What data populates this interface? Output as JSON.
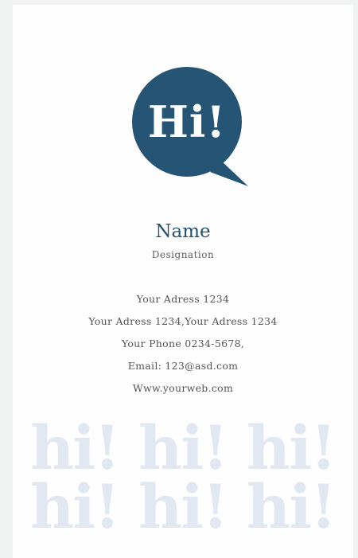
{
  "logo": {
    "text": "Hi!",
    "bubble_color": "#265474",
    "icon": "speech-bubble-icon"
  },
  "name": "Name",
  "designation": "Designation",
  "contact": {
    "address_line_1": "Your Adress 1234",
    "address_line_2": "Your Adress 1234,Your Adress 1234",
    "phone": "Your Phone 0234-5678,",
    "email": "Email: 123@asd.com",
    "website": "Www.yourweb.com"
  },
  "pattern": {
    "row_1": "hi! hi! hi!",
    "row_2": "hi! hi! hi!",
    "color": "#e2e8f2"
  },
  "colors": {
    "name": "#23526d",
    "background": "#f1f3f3"
  }
}
